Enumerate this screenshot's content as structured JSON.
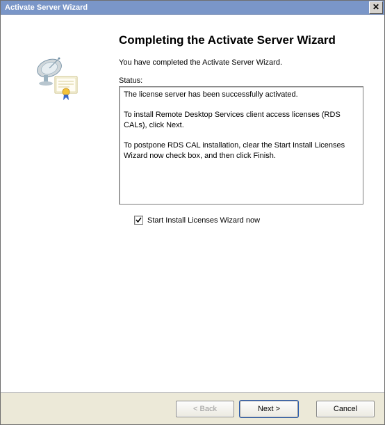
{
  "window": {
    "title": "Activate Server Wizard"
  },
  "main": {
    "heading": "Completing the Activate Server Wizard",
    "intro": "You have completed the Activate Server Wizard.",
    "status_label": "Status:",
    "status_lines": {
      "l1": "The license server has been successfully activated.",
      "l2": "To install Remote Desktop Services client access licenses (RDS CALs), click Next.",
      "l3": "To postpone RDS CAL installation, clear the Start Install Licenses Wizard now check box, and then click Finish."
    },
    "checkbox": {
      "checked": true,
      "label": "Start Install Licenses Wizard now"
    }
  },
  "footer": {
    "back": "< Back",
    "next": "Next >",
    "cancel": "Cancel"
  }
}
